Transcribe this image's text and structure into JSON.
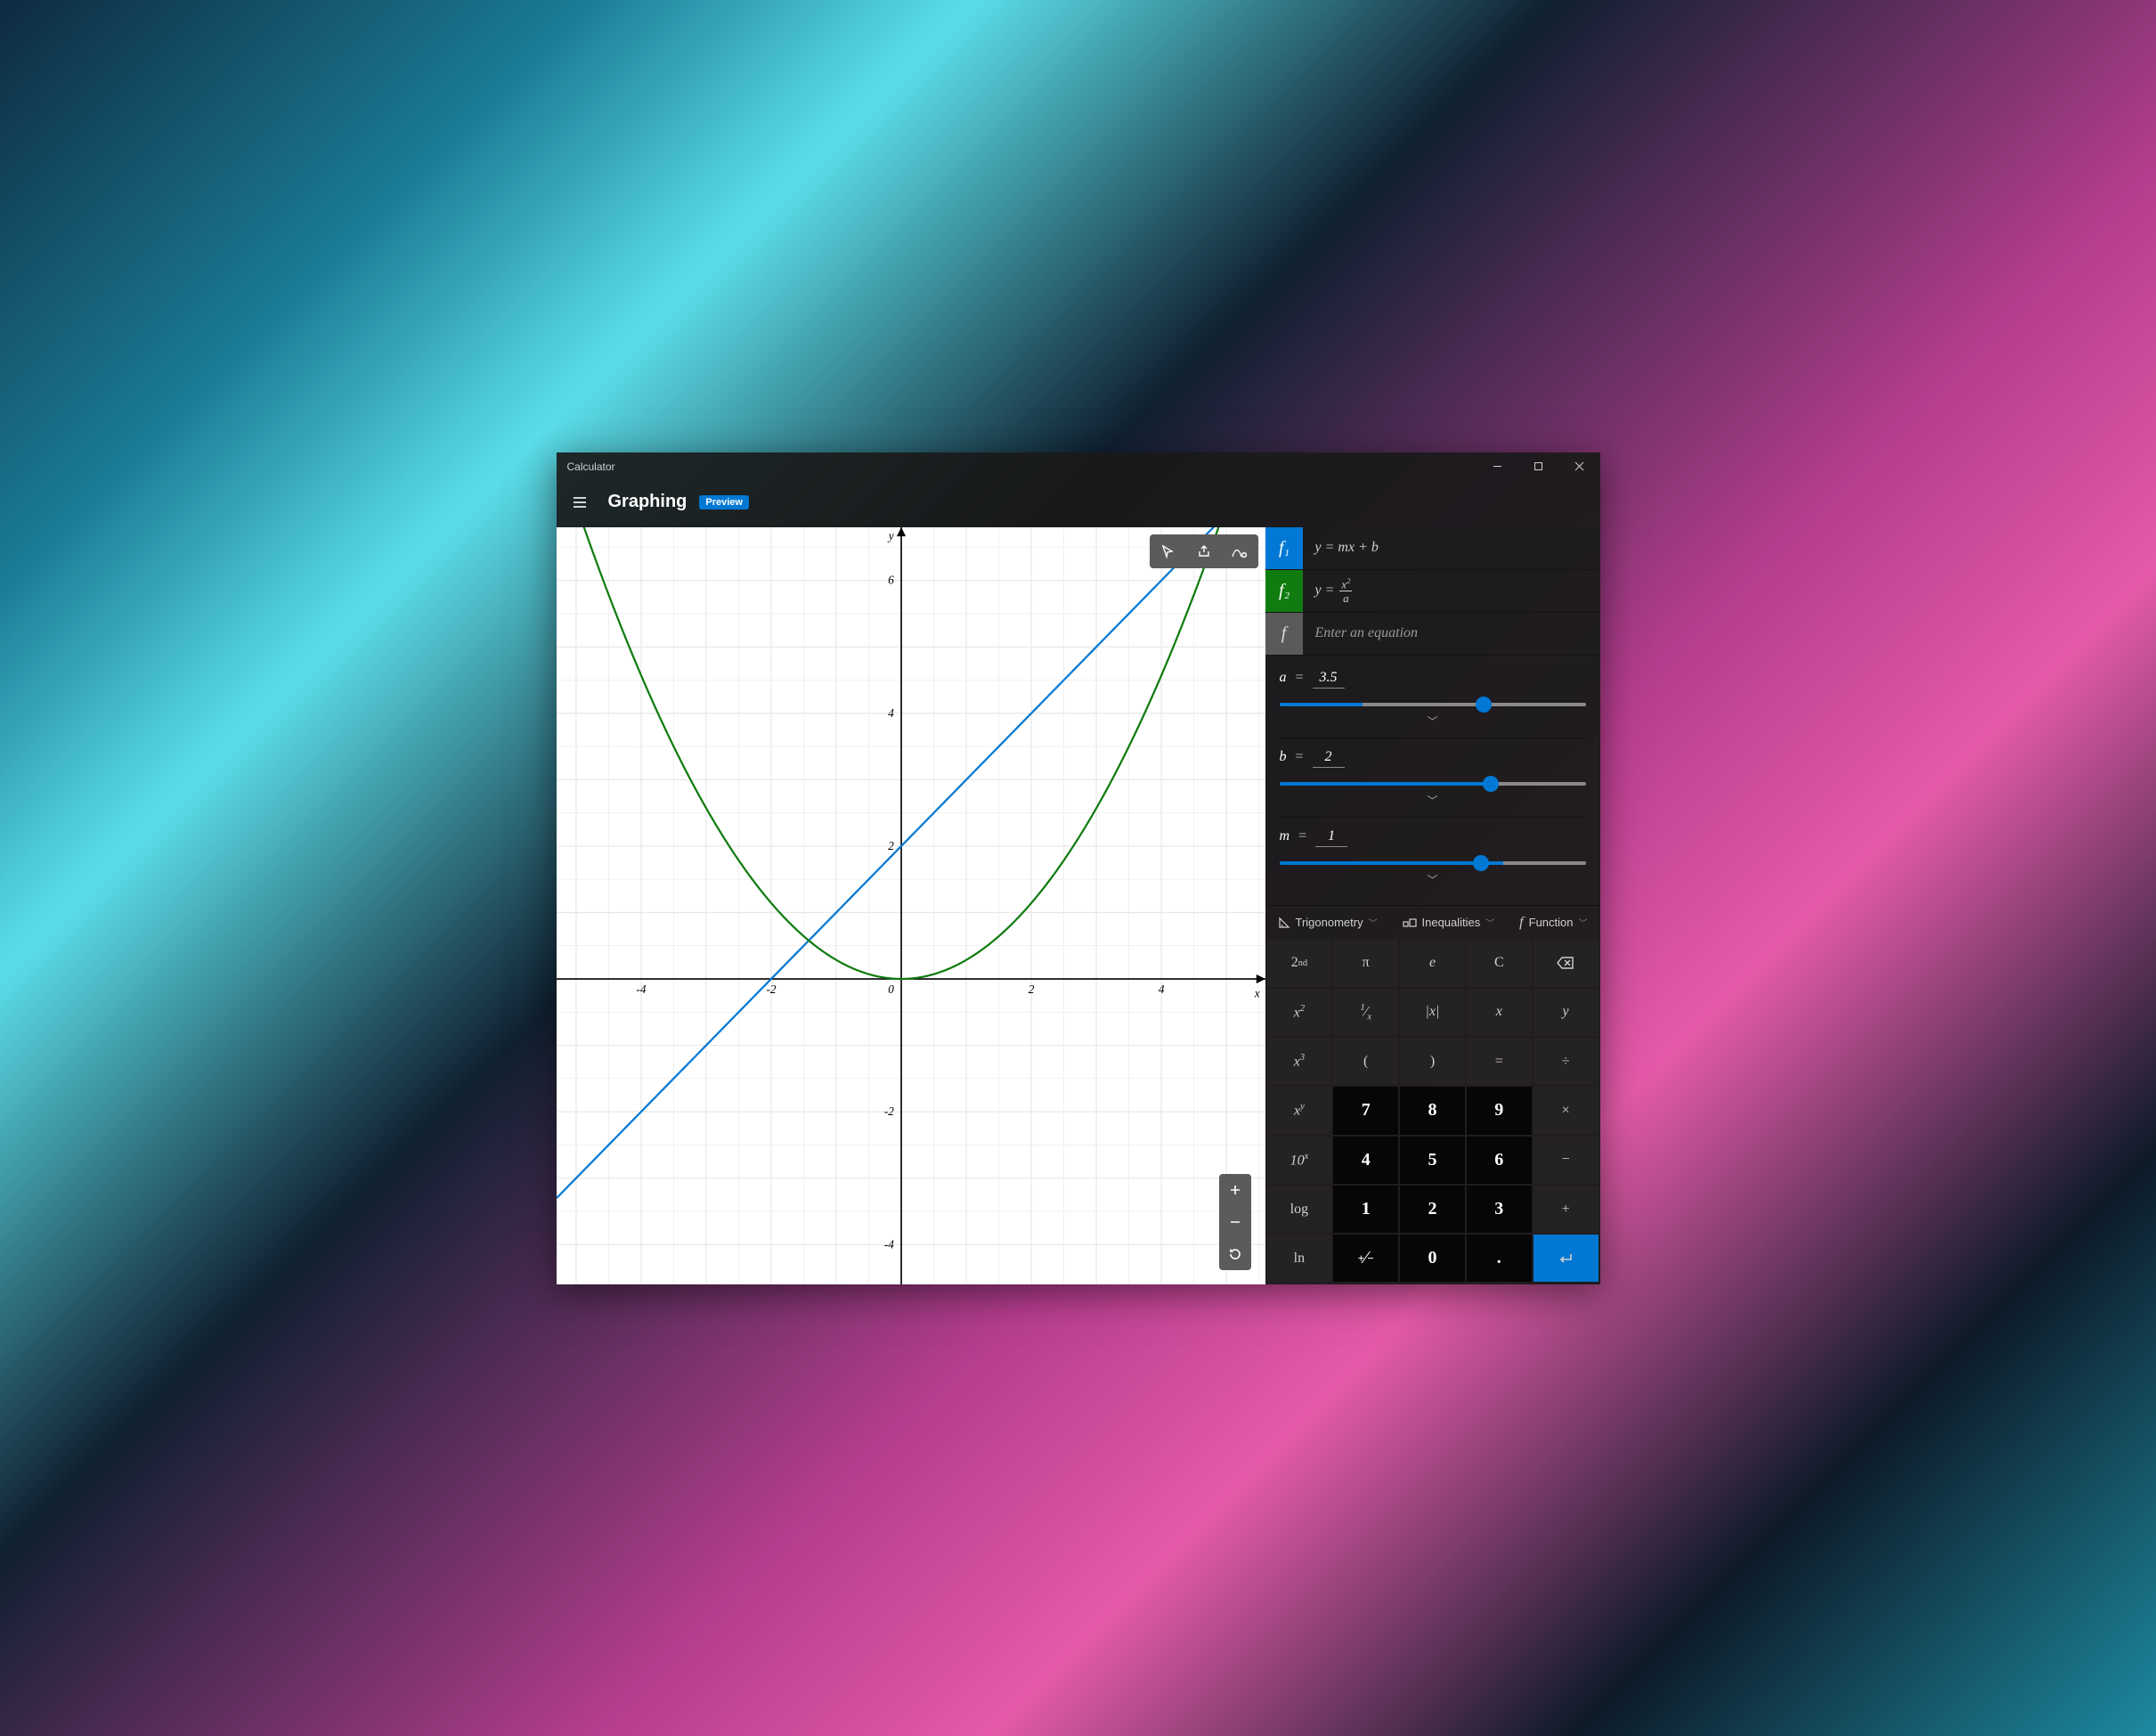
{
  "window": {
    "title": "Calculator"
  },
  "header": {
    "mode": "Graphing",
    "badge": "Preview"
  },
  "equations": [
    {
      "id": "f1",
      "label": "f",
      "sub": "1",
      "color": "#0078d4",
      "expr_html": "y = mx + b"
    },
    {
      "id": "f2",
      "label": "f",
      "sub": "2",
      "color": "#107c10",
      "expr_html": "y = x² / a"
    }
  ],
  "equation_input": {
    "placeholder": "Enter an equation"
  },
  "variables": [
    {
      "name": "a",
      "value": "3.5",
      "min": -10,
      "max": 10,
      "slider_pct": 27
    },
    {
      "name": "b",
      "value": "2",
      "min": -5,
      "max": 5,
      "slider_pct": 68
    },
    {
      "name": "m",
      "value": "1",
      "min": -3,
      "max": 3,
      "slider_pct": 73
    }
  ],
  "function_tabs": {
    "trig": "Trigonometry",
    "ineq": "Inequalities",
    "func": "Function"
  },
  "keypad": {
    "r0": [
      "2ⁿᵈ",
      "π",
      "e",
      "C",
      "⌫"
    ],
    "r1": [
      "x²",
      "¹⁄ₓ",
      "|x|",
      "x",
      "y"
    ],
    "r2": [
      "x³",
      "(",
      ")",
      "=",
      "÷"
    ],
    "r3": [
      "xʸ",
      "7",
      "8",
      "9",
      "×"
    ],
    "r4": [
      "10ˣ",
      "4",
      "5",
      "6",
      "−"
    ],
    "r5": [
      "log",
      "1",
      "2",
      "3",
      "+"
    ],
    "r6": [
      "ln",
      "⁺⁄₋",
      "0",
      ".",
      "↵"
    ]
  },
  "chart_data": {
    "type": "line",
    "title": "",
    "xlabel": "x",
    "ylabel": "y",
    "xlim": [
      -5.3,
      5.6
    ],
    "ylim": [
      -4.6,
      6.8
    ],
    "xticks": [
      -4,
      -2,
      0,
      2,
      4
    ],
    "yticks": [
      -4,
      -2,
      0,
      2,
      4,
      6
    ],
    "grid": true,
    "series": [
      {
        "name": "f1: y = m·x + b  (m=1, b=2)",
        "color": "#0078d4",
        "x": [
          -5.3,
          -4,
          -2,
          0,
          2,
          4,
          5.6
        ],
        "values": [
          -3.3,
          -2,
          0,
          2,
          4,
          6,
          7.6
        ]
      },
      {
        "name": "f2: y = x² / a  (a=3.5)",
        "color": "#107c10",
        "x": [
          -5,
          -4,
          -3,
          -2,
          -1,
          0,
          1,
          2,
          3,
          4,
          5
        ],
        "values": [
          7.14,
          4.57,
          2.57,
          1.14,
          0.29,
          0,
          0.29,
          1.14,
          2.57,
          4.57,
          7.14
        ]
      }
    ]
  }
}
